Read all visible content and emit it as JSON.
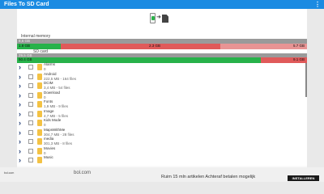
{
  "app": {
    "title": "Files To SD Card",
    "menu_glyph": "⋮"
  },
  "transfer_icon": {
    "from": "phone-icon",
    "arrow": "➜",
    "to": "sd-card-icon"
  },
  "internal": {
    "label": "Internal memory",
    "dark_bar_left": "8,6 GB",
    "used_text": "1.8 GB",
    "free_text": "2.3 GB",
    "total_text": "5.7 GB",
    "fill_fraction": 0.15,
    "fill2_fraction": 0.7
  },
  "sd": {
    "label": "SD card",
    "dark_bar_left": "29,5 GB",
    "used_text": "50.4 GB",
    "total_text": "9.1 GB",
    "fill_fraction": 0.84
  },
  "colors": {
    "appbar": "#1b8be2",
    "used": "#27b24a",
    "free": "#e05a5a",
    "free_light": "#e89494",
    "folder": "#f3c244",
    "chevron": "#1e3a73"
  },
  "folders": [
    {
      "name": "Alarms",
      "meta": "0"
    },
    {
      "name": "Android",
      "meta": "222,5 MB - 164 files"
    },
    {
      "name": "DCIM",
      "meta": "3,4 MB - 54 files"
    },
    {
      "name": "Download",
      "meta": "0"
    },
    {
      "name": "Fonts",
      "meta": "1,9 MB - 9 files"
    },
    {
      "name": "Image",
      "meta": "4,7 MB - 5 files"
    },
    {
      "name": "Kids Mode",
      "meta": "0"
    },
    {
      "name": "MapsWithMe",
      "meta": "304,7 MB - 28 files"
    },
    {
      "name": "media",
      "meta": "301,3 MB - 8 files"
    },
    {
      "name": "Movies",
      "meta": "0"
    },
    {
      "name": "Music",
      "meta": ""
    }
  ],
  "ad": {
    "logo_text": "bol.com",
    "brand": "bol.com",
    "text": "Ruim 15 mln artikelen Achteraf betalen mogelijk",
    "cta": "INSTALLEREN"
  }
}
